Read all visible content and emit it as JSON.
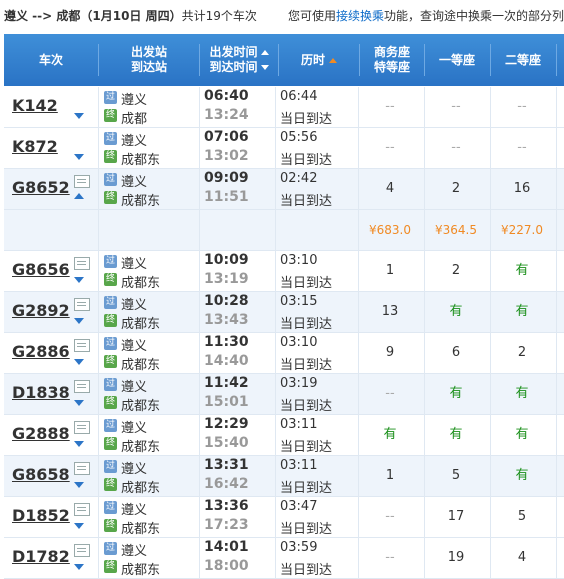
{
  "topbar": {
    "route": "遵义 --> 成都（1月10日 周四）",
    "count_text": "共计19个车次",
    "hint_prefix": "您可使用",
    "hint_link": "接续换乘",
    "hint_suffix": "功能，查询途中换乘一次的部分列"
  },
  "header": {
    "train": "车次",
    "station_line1": "出发站",
    "station_line2": "到达站",
    "time_line1": "出发时间",
    "time_line2": "到达时间",
    "duration": "历时",
    "business_line1": "商务座",
    "business_line2": "特等座",
    "first": "一等座",
    "second": "二等座"
  },
  "icons": {
    "depart": "过",
    "arrive": "终"
  },
  "rows": [
    {
      "train": "K142",
      "from": "遵义",
      "to": "成都",
      "dep": "06:40",
      "arr": "13:24",
      "dur": "06:44",
      "day": "当日到达",
      "business": "--",
      "first": "--",
      "second": "--",
      "expand": "down",
      "card": false
    },
    {
      "train": "K872",
      "from": "遵义",
      "to": "成都东",
      "dep": "07:06",
      "arr": "13:02",
      "dur": "05:56",
      "day": "当日到达",
      "business": "--",
      "first": "--",
      "second": "--",
      "expand": "down",
      "card": false
    },
    {
      "train": "G8652",
      "from": "遵义",
      "to": "成都东",
      "dep": "09:09",
      "arr": "11:51",
      "dur": "02:42",
      "day": "当日到达",
      "business": "4",
      "first": "2",
      "second": "16",
      "expand": "up",
      "card": true
    },
    {
      "price": true,
      "business": "¥683.0",
      "first": "¥364.5",
      "second": "¥227.0"
    },
    {
      "train": "G8656",
      "from": "遵义",
      "to": "成都东",
      "dep": "10:09",
      "arr": "13:19",
      "dur": "03:10",
      "day": "当日到达",
      "business": "1",
      "first": "2",
      "second": "有",
      "expand": "down",
      "card": true
    },
    {
      "train": "G2892",
      "from": "遵义",
      "to": "成都东",
      "dep": "10:28",
      "arr": "13:43",
      "dur": "03:15",
      "day": "当日到达",
      "business": "13",
      "first": "有",
      "second": "有",
      "expand": "down",
      "card": true
    },
    {
      "train": "G2886",
      "from": "遵义",
      "to": "成都东",
      "dep": "11:30",
      "arr": "14:40",
      "dur": "03:10",
      "day": "当日到达",
      "business": "9",
      "first": "6",
      "second": "2",
      "expand": "down",
      "card": true
    },
    {
      "train": "D1838",
      "from": "遵义",
      "to": "成都东",
      "dep": "11:42",
      "arr": "15:01",
      "dur": "03:19",
      "day": "当日到达",
      "business": "--",
      "first": "有",
      "second": "有",
      "expand": "down",
      "card": true
    },
    {
      "train": "G2888",
      "from": "遵义",
      "to": "成都东",
      "dep": "12:29",
      "arr": "15:40",
      "dur": "03:11",
      "day": "当日到达",
      "business": "有",
      "first": "有",
      "second": "有",
      "expand": "down",
      "card": true
    },
    {
      "train": "G8658",
      "from": "遵义",
      "to": "成都东",
      "dep": "13:31",
      "arr": "16:42",
      "dur": "03:11",
      "day": "当日到达",
      "business": "1",
      "first": "5",
      "second": "有",
      "expand": "down",
      "card": true
    },
    {
      "train": "D1852",
      "from": "遵义",
      "to": "成都东",
      "dep": "13:36",
      "arr": "17:23",
      "dur": "03:47",
      "day": "当日到达",
      "business": "--",
      "first": "17",
      "second": "5",
      "expand": "down",
      "card": true
    },
    {
      "train": "D1782",
      "from": "遵义",
      "to": "成都东",
      "dep": "14:01",
      "arr": "18:00",
      "dur": "03:59",
      "day": "当日到达",
      "business": "--",
      "first": "19",
      "second": "4",
      "expand": "down",
      "card": true
    }
  ],
  "colors": {
    "header_bg": "#2a73c5",
    "seat_available": "#1a8f1a",
    "price": "#f08a24",
    "link": "#0d6bc8"
  }
}
